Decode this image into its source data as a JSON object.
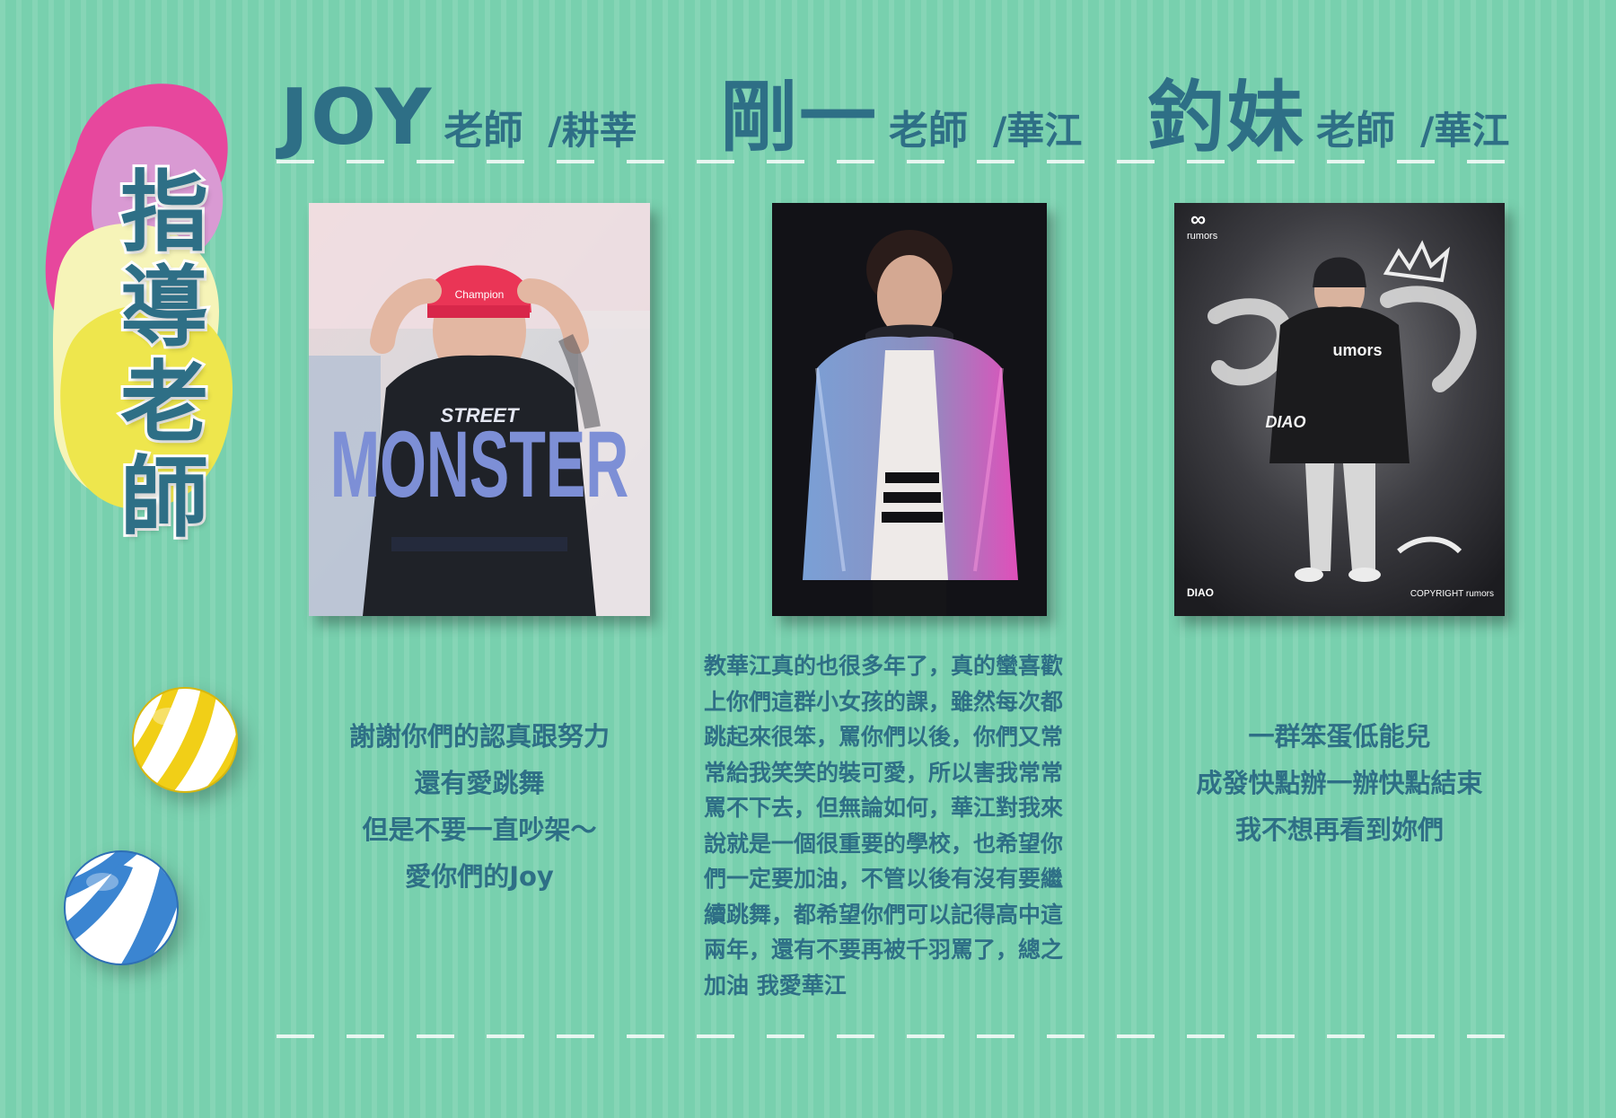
{
  "page": {
    "title_chars": [
      "指",
      "導",
      "老",
      "師"
    ]
  },
  "teachers": [
    {
      "name": "JOY",
      "role": "老師",
      "campus": "/耕莘",
      "message_lines": [
        "謝謝你們的認真跟努力",
        "還有愛跳舞",
        "但是不要一直吵架～",
        "愛你們的Joy"
      ]
    },
    {
      "name": "剛一",
      "role": "老師",
      "campus": "/華江",
      "message_lines": [
        "教華江真的也很多年了，真的蠻喜歡",
        "上你們這群小女孩的課，雖然每次都",
        "跳起來很笨，罵你們以後，你們又常",
        "常給我笑笑的裝可愛，所以害我常常",
        "罵不下去，但無論如何，華江對我來",
        "說就是一個很重要的學校，也希望你",
        "們一定要加油，不管以後有沒有要繼",
        "續跳舞，都希望你們可以記得高中這",
        "兩年，還有不要再被千羽罵了，總之",
        "加油  我愛華江"
      ]
    },
    {
      "name": "釣妹",
      "role": "老師",
      "campus": "/華江",
      "message_lines": [
        "一群笨蛋低能兒",
        "成發快點辦一辦快點結束",
        "我不想再看到妳們"
      ]
    }
  ],
  "photos": {
    "joy": {
      "shirt_text_top": "STREET",
      "shirt_text_main": "MONSTER",
      "hat_text": "Champion"
    },
    "diao": {
      "logo_text": "rumors",
      "bottom_left": "DIAO",
      "bottom_right": "COPYRIGHT rumors",
      "shirt_text": "umors",
      "tag_text": "DIAO"
    }
  },
  "colors": {
    "background": "#78d0ae",
    "text": "#2e6f86",
    "dash": "#ffffff",
    "blob_pink": "#e7479d",
    "blob_lilac": "#d99ad3",
    "blob_cream": "#f6f4b8",
    "blob_yellow": "#eee64d"
  },
  "icons": {
    "title_blob": "blob-shapes",
    "ball_1": "beach-ball-icon",
    "ball_2": "beach-ball-icon"
  }
}
